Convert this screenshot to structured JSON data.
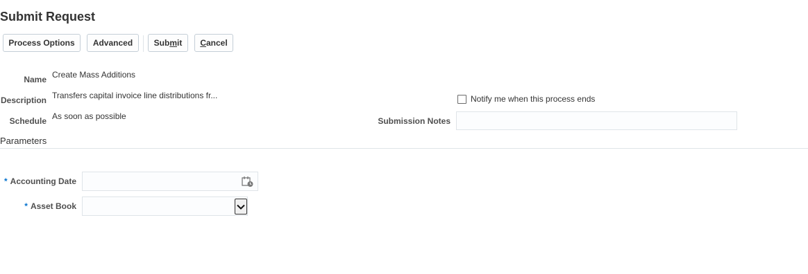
{
  "page": {
    "title": "Submit Request"
  },
  "toolbar": {
    "process_options": "Process Options",
    "advanced": "Advanced",
    "submit_pre": "Sub",
    "submit_u": "m",
    "submit_post": "it",
    "cancel_u": "C",
    "cancel_post": "ancel"
  },
  "details": {
    "name_label": "Name",
    "name_value": "Create Mass Additions",
    "description_label": "Description",
    "description_value": "Transfers capital invoice line distributions fr...",
    "schedule_label": "Schedule",
    "schedule_value": "As soon as possible",
    "notify_label": "Notify me when this process ends",
    "notify_checked": false,
    "submission_notes_label": "Submission Notes",
    "submission_notes_value": ""
  },
  "parameters": {
    "section_title": "Parameters",
    "required_marker": "*",
    "accounting_date_label": "Accounting Date",
    "accounting_date_value": "",
    "asset_book_label": "Asset Book",
    "asset_book_value": ""
  },
  "icons": {
    "calendar": "calendar-icon",
    "dropdown": "chevron-down-icon"
  }
}
